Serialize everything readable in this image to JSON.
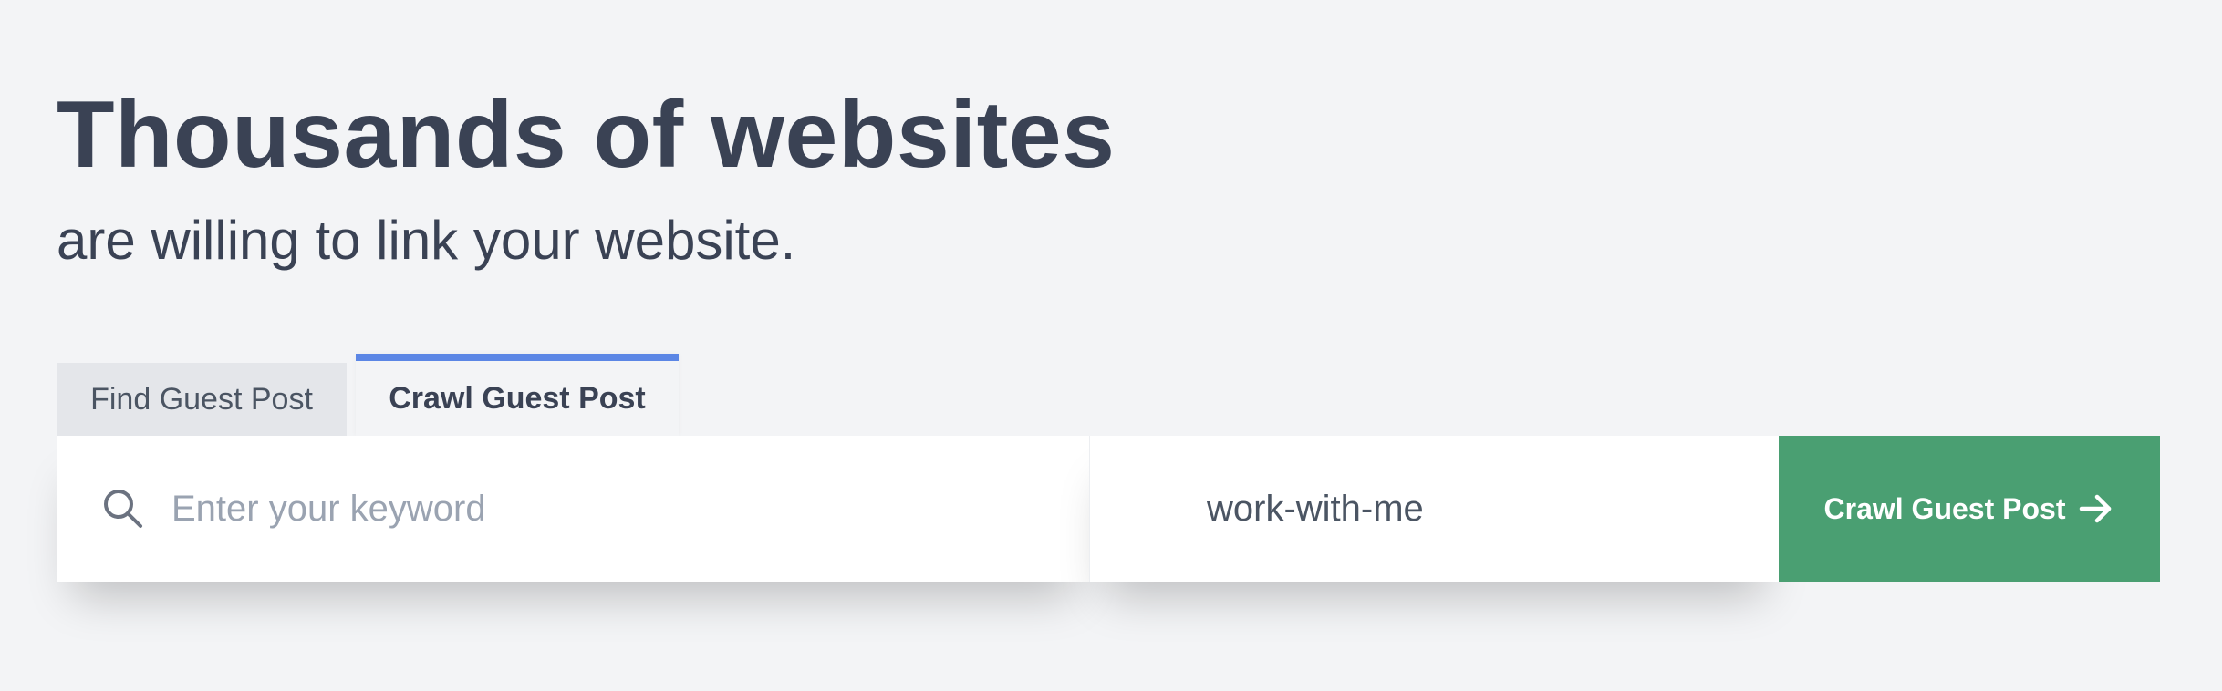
{
  "hero": {
    "headline": "Thousands of websites",
    "subhead": "are willing to link your website."
  },
  "tabs": [
    {
      "label": "Find Guest Post",
      "active": false
    },
    {
      "label": "Crawl Guest Post",
      "active": true
    }
  ],
  "search": {
    "keyword_placeholder": "Enter your keyword",
    "keyword_value": "",
    "path_value": "work-with-me",
    "button_label": "Crawl Guest Post",
    "search_icon": "search-icon",
    "button_icon": "arrow-right-icon"
  },
  "colors": {
    "background": "#f3f4f6",
    "text": "#3a4254",
    "accent_tab": "#5b86e5",
    "button": "#4a9f72",
    "placeholder": "#9aa3b1"
  }
}
